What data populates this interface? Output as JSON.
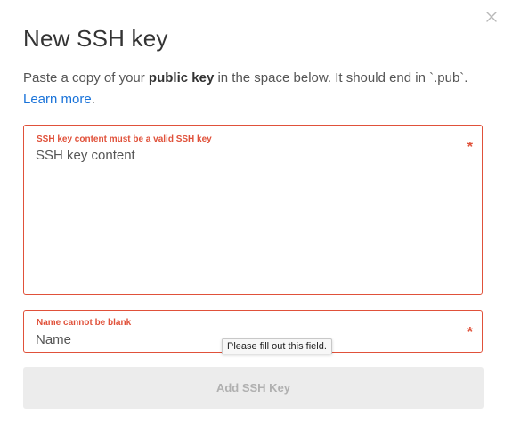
{
  "modal": {
    "title": "New SSH key",
    "close_icon": "close-icon"
  },
  "description": {
    "part1": "Paste a copy of your ",
    "bold": "public key",
    "part2": " in the space below. It should end in `.pub`.",
    "link": "Learn more",
    "period": "."
  },
  "key_field": {
    "error": "SSH key content must be a valid SSH key",
    "placeholder": "SSH key content",
    "value": "",
    "required_marker": "*"
  },
  "name_field": {
    "error": "Name cannot be blank",
    "placeholder": "Name",
    "value": "",
    "required_marker": "*"
  },
  "tooltip": {
    "text": "Please fill out this field."
  },
  "submit": {
    "label": "Add SSH Key",
    "enabled": false
  },
  "colors": {
    "error": "#e0513a",
    "link": "#1a73d9",
    "button_disabled_bg": "#ececec",
    "button_disabled_text": "#b0b0b0"
  }
}
